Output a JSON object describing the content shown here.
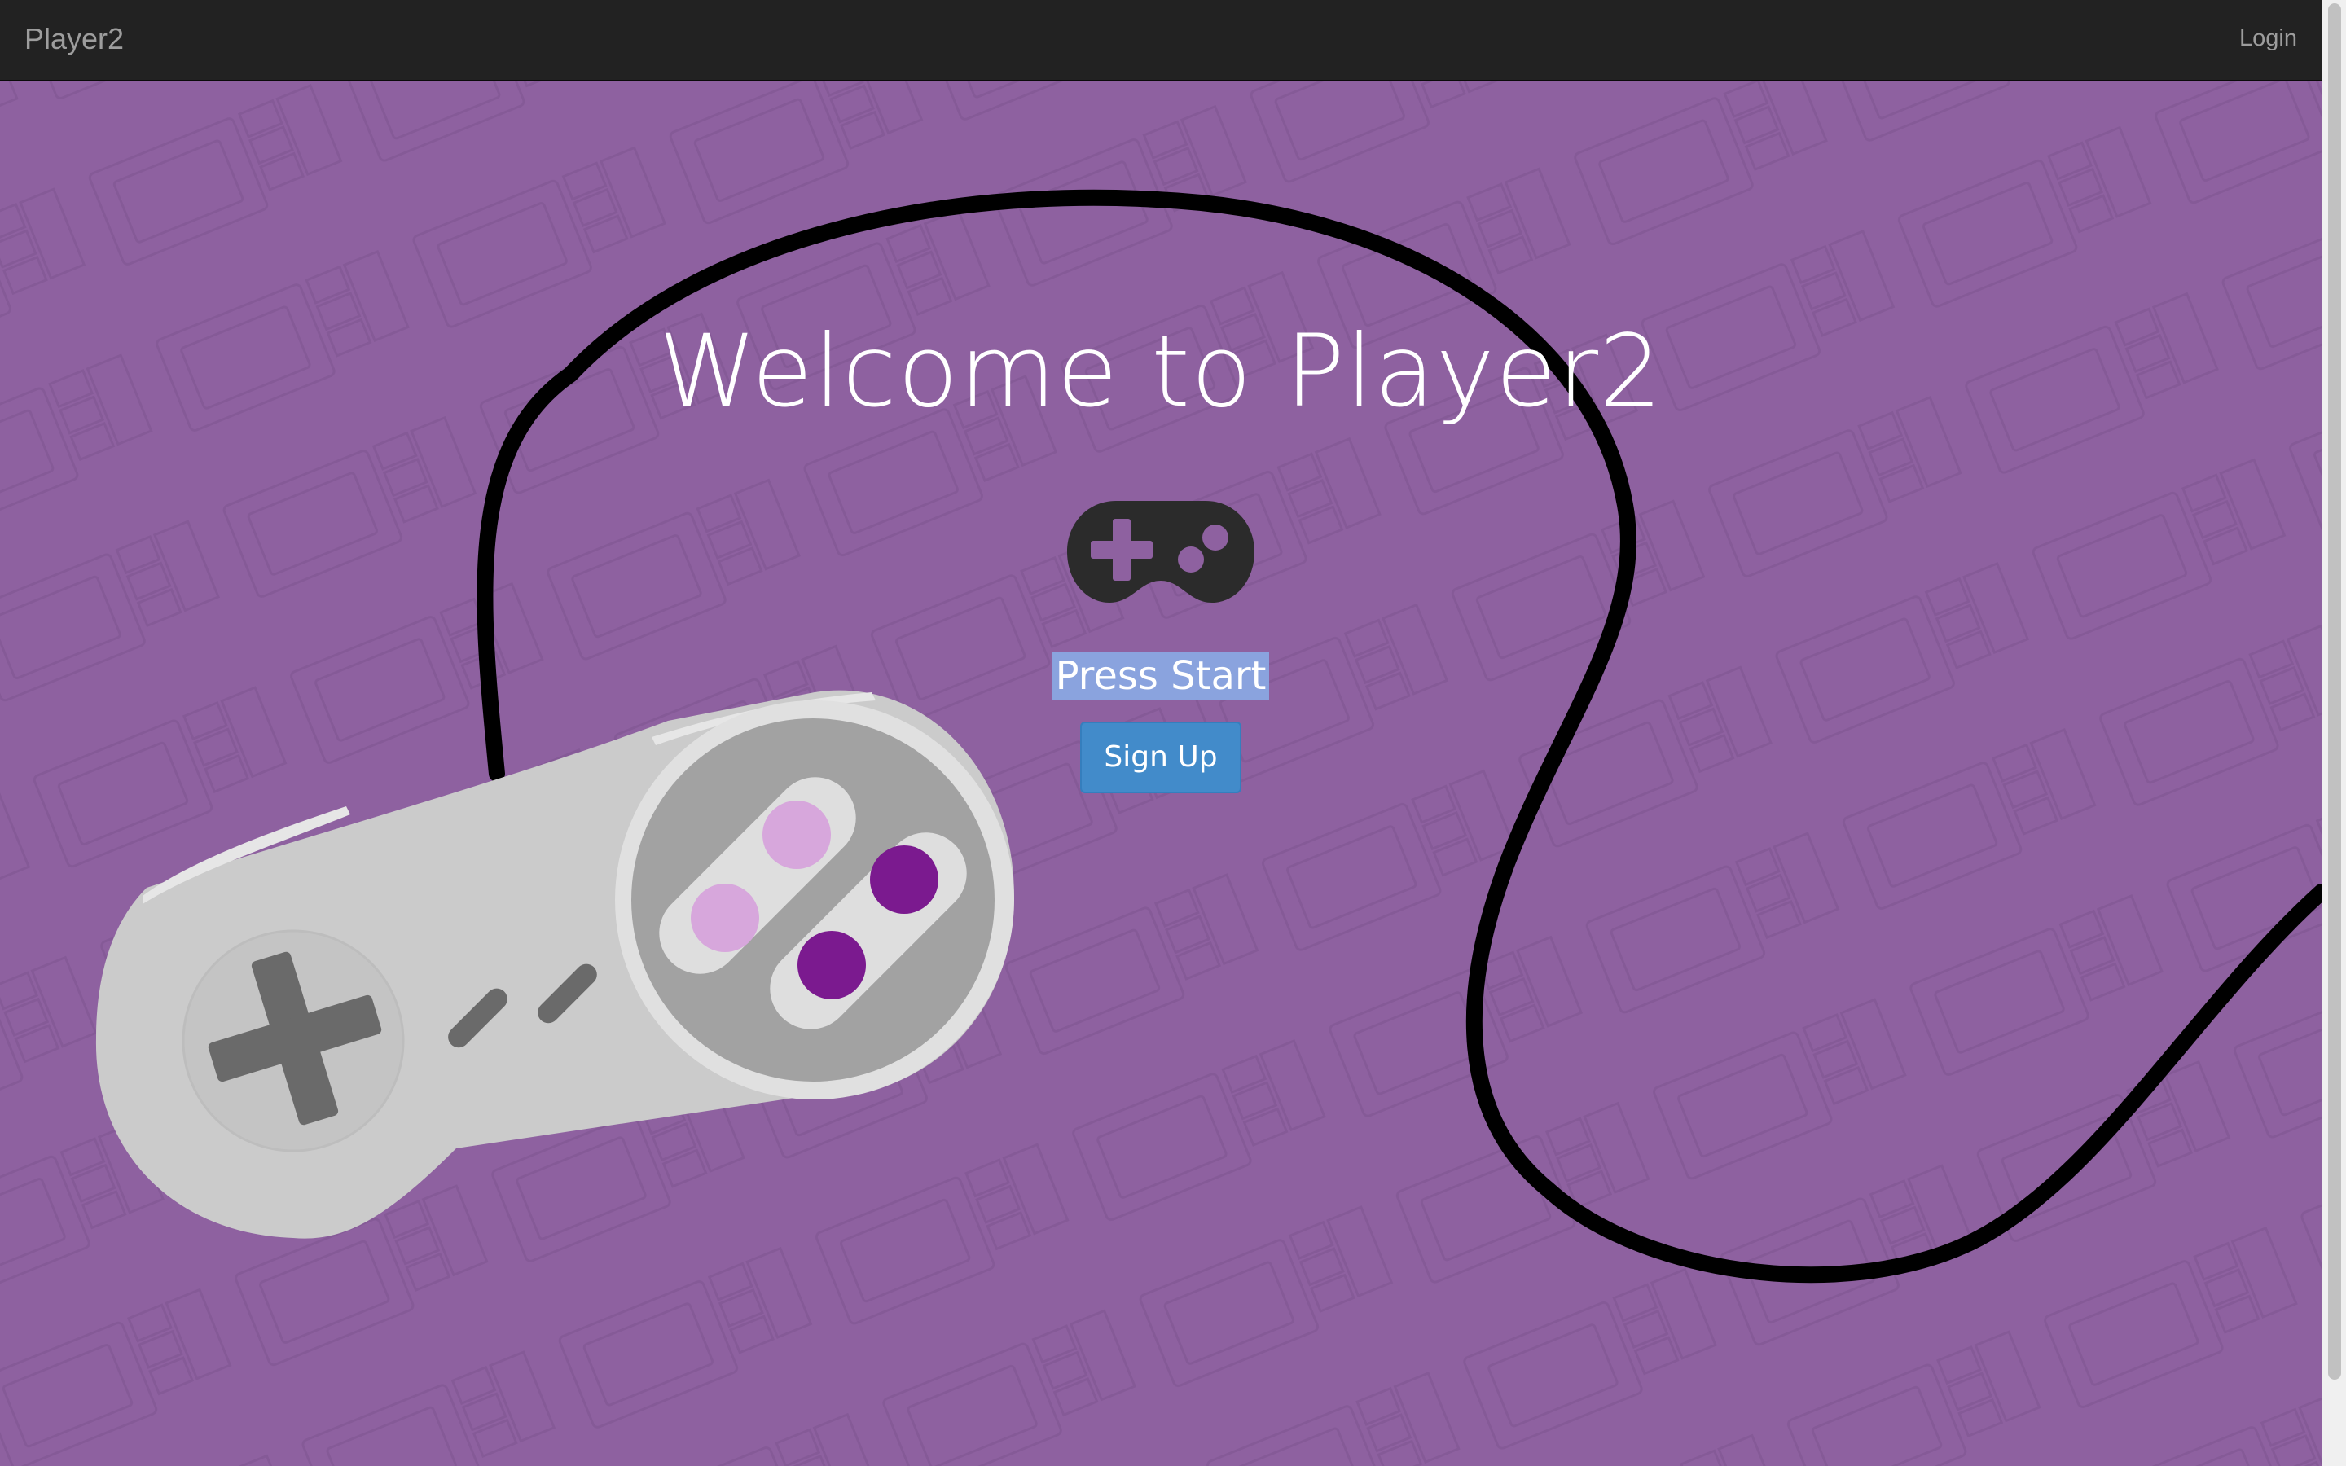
{
  "navbar": {
    "brand": "Player2",
    "login_label": "Login"
  },
  "hero": {
    "title": "Welcome to Player2",
    "press_start": "Press Start",
    "signup_label": "Sign Up",
    "icon": "gamepad-icon"
  },
  "background": {
    "decoration": "snes-controller-illustration",
    "pattern": "console-cartridge-pattern"
  },
  "colors": {
    "background": "#8e61a0",
    "navbar": "#222222",
    "button": "#428bca",
    "highlight": "#8aa3de",
    "button_light": "#d8a3dc",
    "button_dark": "#7b1a8f"
  }
}
